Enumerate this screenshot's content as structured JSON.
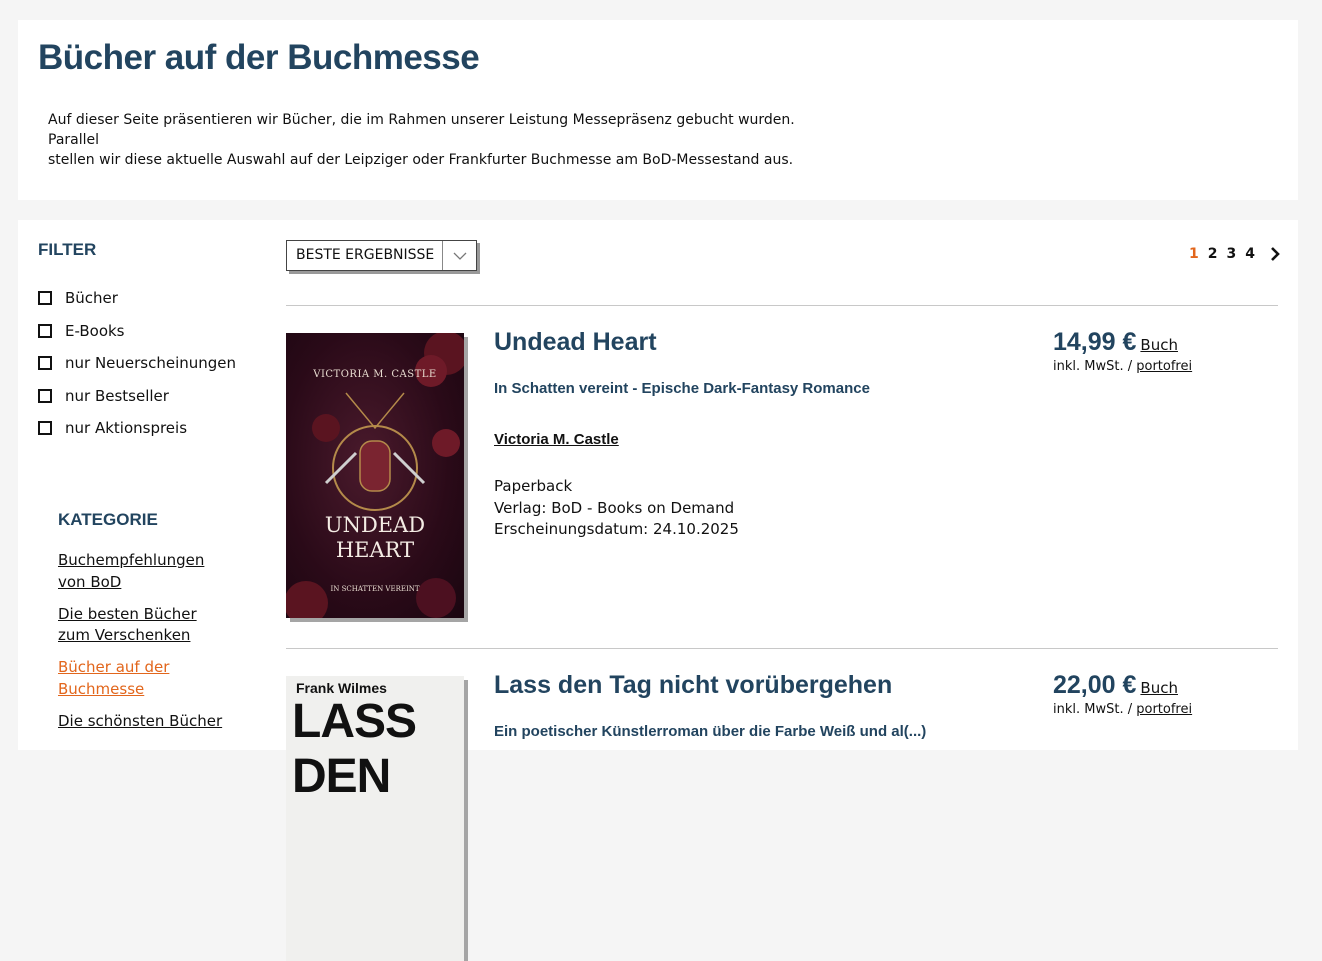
{
  "page": {
    "title": "Bücher auf der Buchmesse",
    "intro_line1": "Auf dieser Seite präsentieren wir Bücher, die im Rahmen unserer Leistung Messepräsenz gebucht wurden. Parallel",
    "intro_line2": "stellen wir diese aktuelle Auswahl auf der Leipziger oder Frankfurter Buchmesse am BoD-Messestand aus."
  },
  "filter": {
    "title": "FILTER",
    "items": [
      "Bücher",
      "E-Books",
      "nur Neuerscheinungen",
      "nur Bestseller",
      "nur Aktionspreis"
    ]
  },
  "kategorie": {
    "title": "KATEGORIE",
    "items": [
      "Buchempfehlungen von BoD",
      "Die besten Bücher zum Verschenken",
      "Bücher auf der Buchmesse",
      "Die schönsten Bücher"
    ]
  },
  "sort": {
    "label": "BESTE ERGEBNISSE"
  },
  "pagination": {
    "pages": [
      "1",
      "2",
      "3",
      "4"
    ],
    "current": "1"
  },
  "books": [
    {
      "title": "Undead Heart",
      "subtitle": "In Schatten vereint - Epische Dark-Fantasy Romance",
      "author": "Victoria M. Castle",
      "format": "Paperback",
      "publisher": "Verlag: BoD - Books on Demand",
      "date": "Erscheinungsdatum: 24.10.2025",
      "price": "14,99 €",
      "price_type": "Buch",
      "tax_prefix": "inkl. MwSt. /",
      "shipping": "portofrei",
      "cover_author": "VICTORIA M. CASTLE",
      "cover_title": "UNDEAD HEART",
      "cover_sub": "IN SCHATTEN VEREINT"
    },
    {
      "title": "Lass den Tag nicht vorübergehen",
      "subtitle": "Ein poetischer Künstlerroman über die Farbe Weiß und al(...)",
      "price": "22,00 €",
      "price_type": "Buch",
      "tax_prefix": "inkl. MwSt. /",
      "shipping": "portofrei",
      "cover_author": "Frank Wilmes",
      "cover_title": "LASS DEN"
    }
  ],
  "colors": {
    "heading": "#22445f",
    "accent": "#e2661c"
  }
}
